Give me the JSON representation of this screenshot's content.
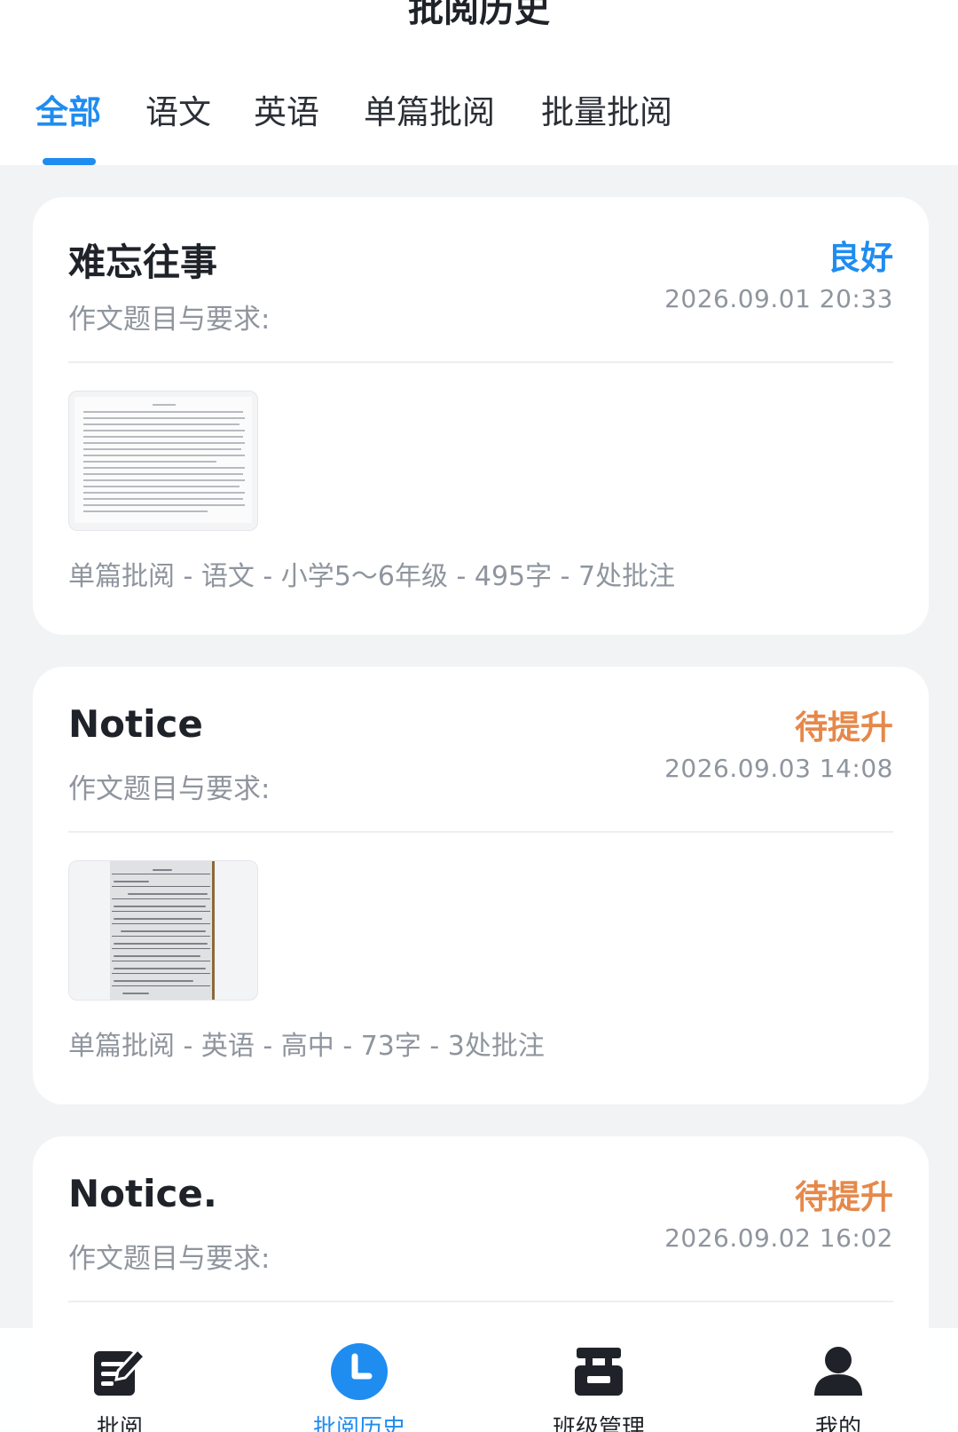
{
  "header": {
    "title": "批阅历史",
    "tabs": [
      {
        "label": "全部",
        "active": true
      },
      {
        "label": "语文",
        "active": false
      },
      {
        "label": "英语",
        "active": false
      },
      {
        "label": "单篇批阅",
        "active": false
      },
      {
        "label": "批量批阅",
        "active": false
      }
    ]
  },
  "records": [
    {
      "title": "难忘往事",
      "grade": "良好",
      "grade_color": "#1f8cf0",
      "prompt_label": "作文题目与要求:",
      "datetime": "2026.09.01 20:33",
      "meta": "单篇批阅 - 语文 - 小学5～6年级 - 495字 - 7处批注",
      "thumbnail": "typed-document"
    },
    {
      "title": "Notice",
      "grade": "待提升",
      "grade_color": "#e5884a",
      "prompt_label": "作文题目与要求:",
      "datetime": "2026.09.03 14:08",
      "meta": "单篇批阅 - 英语 - 高中 - 73字 - 3处批注",
      "thumbnail": "handwritten-page"
    },
    {
      "title": "Notice.",
      "grade": "待提升",
      "grade_color": "#e5884a",
      "prompt_label": "作文题目与要求:",
      "datetime": "2026.09.02 16:02"
    }
  ],
  "bottom_nav": [
    {
      "label": "批阅",
      "icon": "edit-note-icon",
      "active": false
    },
    {
      "label": "批阅历史",
      "icon": "clock-icon",
      "active": true,
      "accent": "#1f8cf0"
    },
    {
      "label": "班级管理",
      "icon": "class-icon",
      "active": false
    },
    {
      "label": "我的",
      "icon": "user-icon",
      "active": false
    }
  ]
}
